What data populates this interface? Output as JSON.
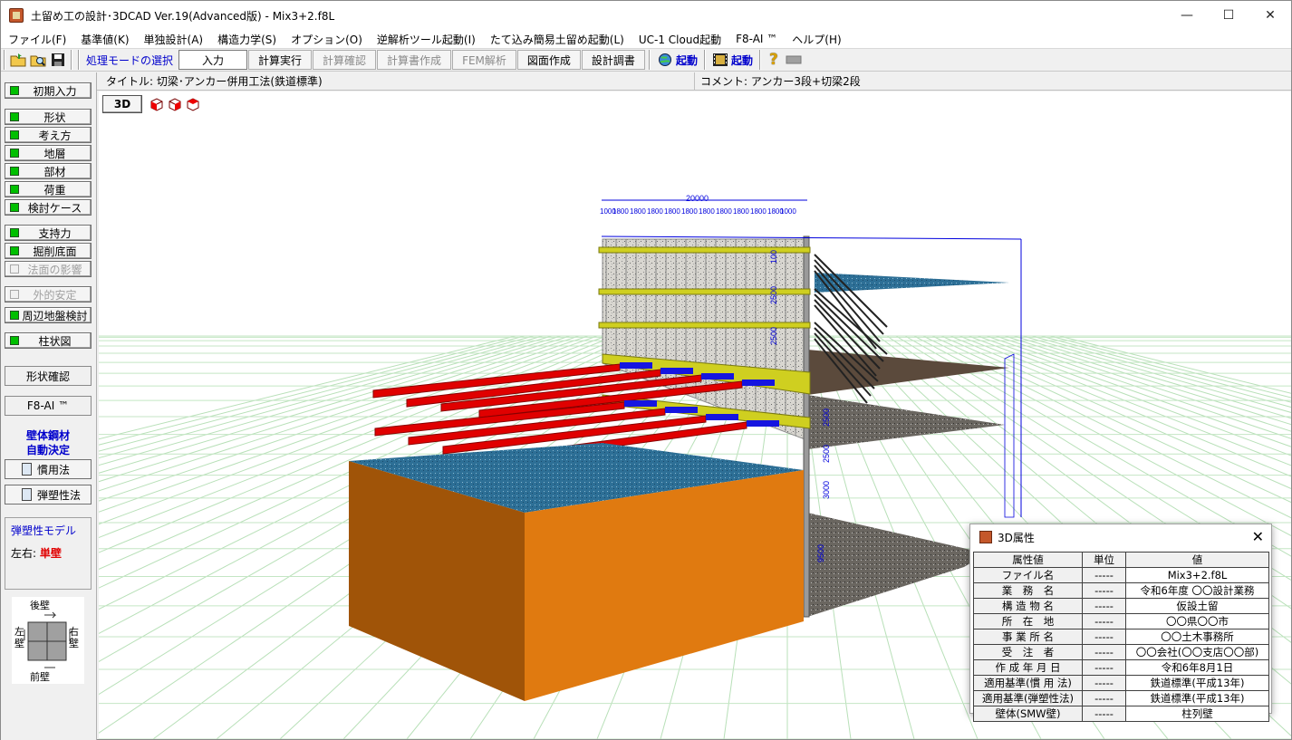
{
  "window": {
    "title": "土留め工の設計･3DCAD Ver.19(Advanced版) - Mix3+2.f8L",
    "controls": {
      "minimize": "—",
      "maximize": "☐",
      "close": "✕"
    }
  },
  "menu": [
    "ファイル(F)",
    "基準値(K)",
    "単独設計(A)",
    "構造力学(S)",
    "オプション(O)",
    "逆解析ツール起動(I)",
    "たて込み簡易土留め起動(L)",
    "UC-1 Cloud起動",
    "F8-AI ™",
    "ヘルプ(H)"
  ],
  "toolbar": {
    "mode_label": "処理モードの選択",
    "buttons": [
      {
        "label": "入力",
        "state": "active"
      },
      {
        "label": "計算実行",
        "state": "enabled"
      },
      {
        "label": "計算確認",
        "state": "disabled"
      },
      {
        "label": "計算書作成",
        "state": "disabled"
      },
      {
        "label": "FEM解析",
        "state": "disabled"
      },
      {
        "label": "図面作成",
        "state": "enabled"
      },
      {
        "label": "設計調書",
        "state": "enabled"
      }
    ],
    "launch1": "起動",
    "launch2": "起動",
    "help": "?"
  },
  "sidebar": {
    "items": [
      {
        "label": "初期入力",
        "enabled": true
      },
      {
        "label": "形状",
        "enabled": true
      },
      {
        "label": "考え方",
        "enabled": true
      },
      {
        "label": "地層",
        "enabled": true
      },
      {
        "label": "部材",
        "enabled": true
      },
      {
        "label": "荷重",
        "enabled": true
      },
      {
        "label": "検討ケース",
        "enabled": true
      },
      {
        "label": "支持力",
        "enabled": true
      },
      {
        "label": "掘削底面",
        "enabled": true
      },
      {
        "label": "法面の影響",
        "enabled": false
      },
      {
        "label": "外的安定",
        "enabled": false
      },
      {
        "label": "周辺地盤検討",
        "enabled": true
      },
      {
        "label": "柱状図",
        "enabled": true
      }
    ],
    "shape_check": "形状確認",
    "f8ai": "F8-AI ™",
    "auto_line1": "壁体鋼材",
    "auto_line2": "自動決定",
    "calc1": "慣用法",
    "calc2": "弾塑性法",
    "model_title": "弾塑性モデル",
    "model_lr_label": "左右:",
    "model_lr_value": "単壁",
    "wall_back": "後壁",
    "wall_front": "前壁",
    "wall_left": "左壁",
    "wall_right": "右壁"
  },
  "content": {
    "title": "タイトル: 切梁･アンカー併用工法(鉄道標準)",
    "comment": "コメント: アンカー3段+切梁2段",
    "btn3d": "3D"
  },
  "scene": {
    "width_total": "20000",
    "spans": [
      "1000",
      "1800",
      "1800",
      "1800",
      "1800",
      "1800",
      "1800",
      "1800",
      "1800",
      "1800",
      "1800",
      "1000"
    ],
    "dims_a": [
      "100",
      "2500",
      "2500"
    ],
    "dims_b": [
      "2500",
      "2500",
      "3000"
    ],
    "dim_depth": "9500",
    "colors": {
      "soil_side": "#e07a10",
      "soil_top": "#2d6f96",
      "wale": "#cfcf20",
      "strut": "#e00000",
      "dim": "#0000dd"
    }
  },
  "attr": {
    "title": "3D属性",
    "close": "✕",
    "headers": [
      "属性値",
      "単位",
      "値"
    ],
    "rows": [
      {
        "k": "ファイル名",
        "u": "-----",
        "v": "Mix3+2.f8L"
      },
      {
        "k": "業　務　名",
        "u": "-----",
        "v": "令和6年度 〇〇設計業務"
      },
      {
        "k": "構 造 物 名",
        "u": "-----",
        "v": "仮設土留"
      },
      {
        "k": "所　在　地",
        "u": "-----",
        "v": "〇〇県〇〇市"
      },
      {
        "k": "事 業 所 名",
        "u": "-----",
        "v": "〇〇土木事務所"
      },
      {
        "k": "受　注　者",
        "u": "-----",
        "v": "〇〇会社(〇〇支店〇〇部)"
      },
      {
        "k": "作 成 年 月 日",
        "u": "-----",
        "v": "令和6年8月1日"
      },
      {
        "k": "適用基準(慣 用 法)",
        "u": "-----",
        "v": "鉄道標準(平成13年)"
      },
      {
        "k": "適用基準(弾塑性法)",
        "u": "-----",
        "v": "鉄道標準(平成13年)"
      },
      {
        "k": "壁体(SMW壁)",
        "u": "-----",
        "v": "柱列壁"
      }
    ]
  }
}
